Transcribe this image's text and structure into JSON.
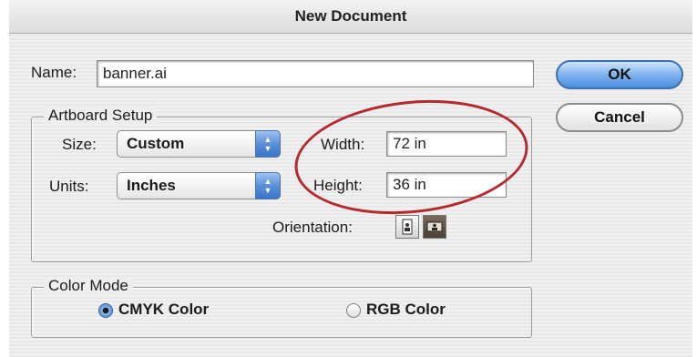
{
  "dialog": {
    "title": "New Document",
    "name_label": "Name:",
    "name_value": "banner.ai",
    "ok_label": "OK",
    "cancel_label": "Cancel"
  },
  "artboard": {
    "title": "Artboard Setup",
    "size_label": "Size:",
    "size_value": "Custom",
    "units_label": "Units:",
    "units_value": "Inches",
    "width_label": "Width:",
    "width_value": "72 in",
    "height_label": "Height:",
    "height_value": "36 in",
    "orientation_label": "Orientation:"
  },
  "color_mode": {
    "title": "Color Mode",
    "cmyk_label": "CMYK Color",
    "rgb_label": "RGB Color",
    "selected": "CMYK Color"
  },
  "annotation": {
    "color": "#b52a2e"
  },
  "icons": [
    "portrait-orientation-icon",
    "landscape-orientation-icon",
    "popup-stepper-icon"
  ]
}
